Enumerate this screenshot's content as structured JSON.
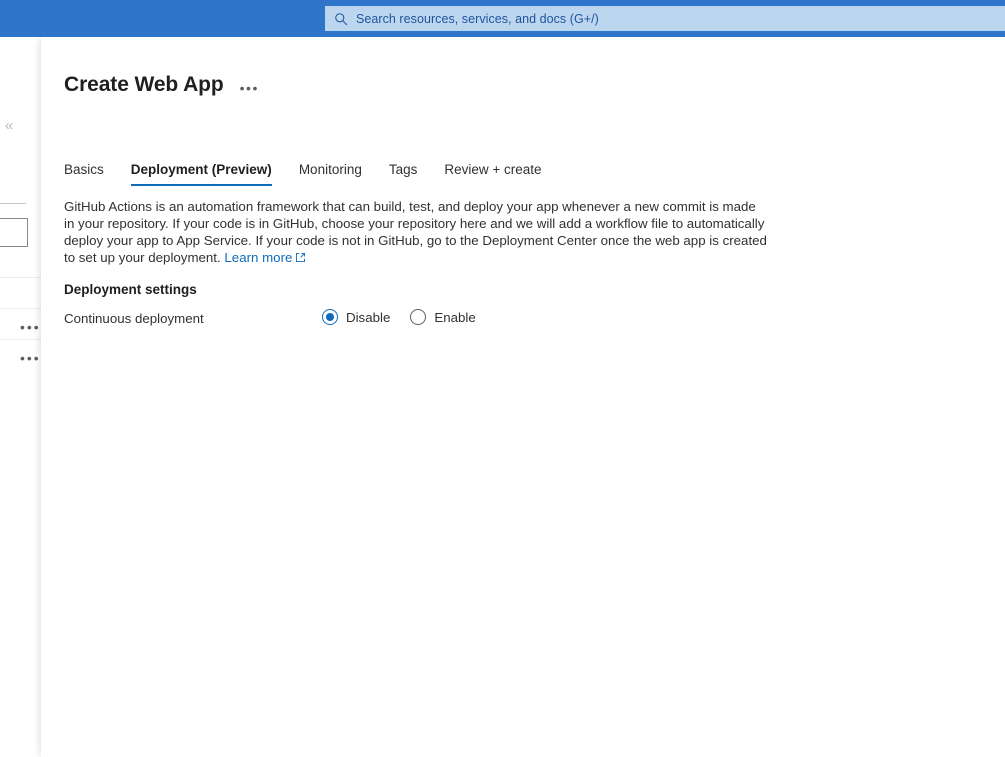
{
  "header": {
    "background_color": "#2f75c9",
    "search": {
      "icon": "search-icon",
      "placeholder": "Search resources, services, and docs (G+/)",
      "value": "",
      "background_color": "#bdd6ef",
      "text_color": "#20559c"
    }
  },
  "background_panel": {
    "collapse_icon": "«",
    "row_ellipsis": "•••",
    "rows": [
      {
        "ellipsis": "•••"
      },
      {
        "ellipsis": "•••"
      }
    ]
  },
  "blade": {
    "title": "Create Web App",
    "more_menu": "•••",
    "tabs": [
      {
        "label": "Basics",
        "active": false
      },
      {
        "label": "Deployment (Preview)",
        "active": true
      },
      {
        "label": "Monitoring",
        "active": false
      },
      {
        "label": "Tags",
        "active": false
      },
      {
        "label": "Review + create",
        "active": false
      }
    ],
    "active_tab_color": "#0f6cbd",
    "description": {
      "text": "GitHub Actions is an automation framework that can build, test, and deploy your app whenever a new commit is made in your repository. If your code is in GitHub, choose your repository here and we will add a workflow file to automatically deploy your app to App Service. If your code is not in GitHub, go to the Deployment Center once the web app is created to set up your deployment.",
      "link_label": "Learn more",
      "link_icon": "external-link-icon",
      "link_color": "#0f6cbd"
    },
    "deployment_settings": {
      "heading": "Deployment settings",
      "continuous_deployment": {
        "label": "Continuous deployment",
        "selected": "Disable",
        "options": [
          {
            "label": "Disable",
            "checked": true
          },
          {
            "label": "Enable",
            "checked": false
          }
        ]
      }
    }
  }
}
